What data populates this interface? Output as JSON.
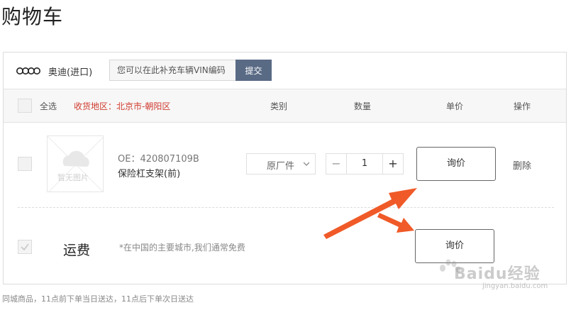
{
  "page": {
    "title": "购物车"
  },
  "vin": {
    "brand": "奥迪(进口)",
    "placeholder": "您可以在此补充车辆VIN编码",
    "submit_label": "提交"
  },
  "header": {
    "select_all": "全选",
    "region": "收货地区：北京市-朝阳区",
    "col_type": "类别",
    "col_qty": "数量",
    "col_price": "单价",
    "col_action": "操作"
  },
  "item": {
    "thumb_text": "暂无图片",
    "oe": "OE：420807109B",
    "name": "保险杠支架(前)",
    "type_value": "原厂件",
    "qty": "1",
    "minus": "−",
    "plus": "+",
    "price_label": "询价",
    "delete_label": "删除"
  },
  "shipping": {
    "label": "运费",
    "note": "*在中国的主要城市,我们通常免费",
    "price_label": "询价"
  },
  "footer": {
    "note": "同城商品，11点前下单当日送达，11点后下单次日送达"
  },
  "watermark": {
    "text": "Baidu经验",
    "sub": "jingyan.baidu.com"
  },
  "colors": {
    "accent_region": "#d03b2f",
    "submit_bg": "#596a85",
    "arrow": "#f05a28"
  }
}
